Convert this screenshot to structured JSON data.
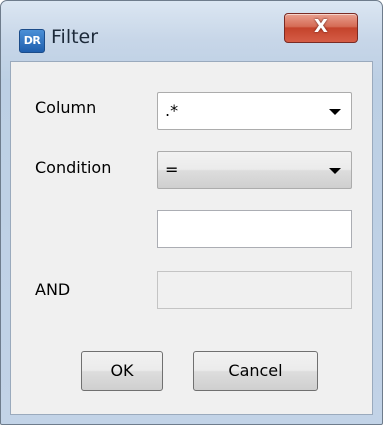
{
  "window": {
    "title": "Filter",
    "app_icon_text": "DR",
    "close_glyph": "X"
  },
  "form": {
    "column_label": "Column",
    "column_value": ".*",
    "condition_label": "Condition",
    "condition_value": "=",
    "value_text": "",
    "and_label": "AND",
    "and_text": ""
  },
  "buttons": {
    "ok": "OK",
    "cancel": "Cancel"
  },
  "icons": {
    "app": "dr-app-icon",
    "close": "close-icon",
    "dropdown": "chevron-down-icon"
  }
}
